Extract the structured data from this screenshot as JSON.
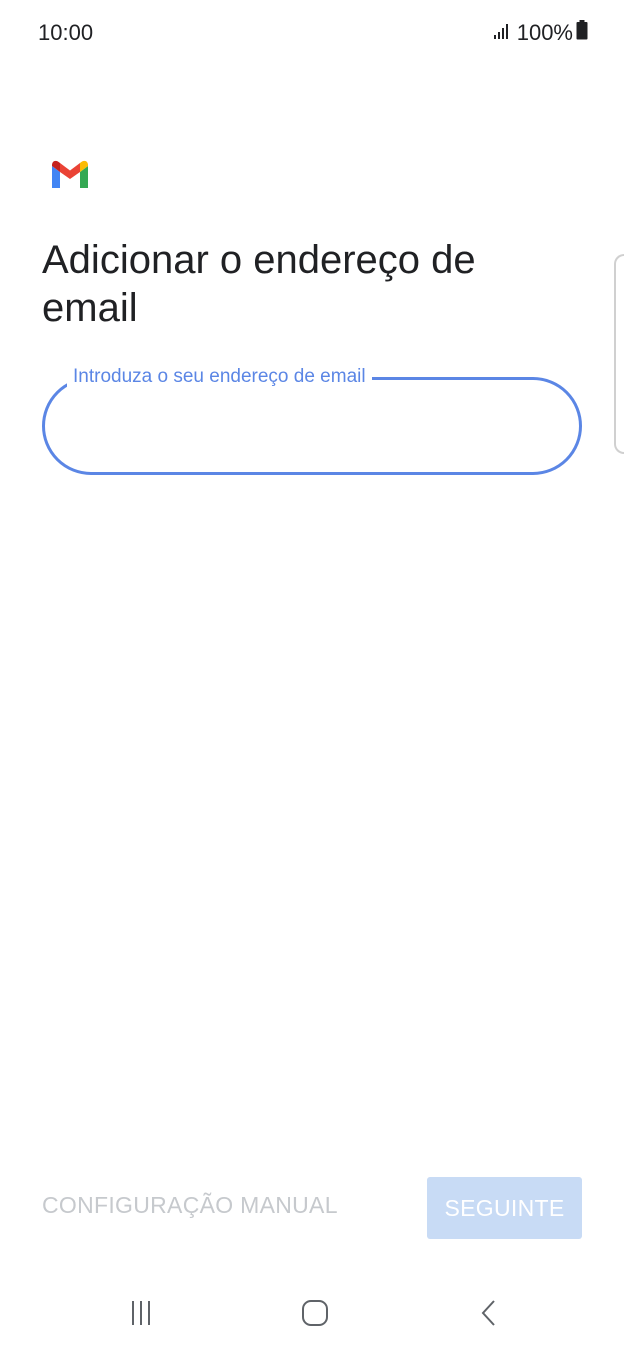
{
  "status_bar": {
    "time": "10:00",
    "battery": "100%",
    "icons": [
      "signal-icon",
      "battery-icon"
    ]
  },
  "app": {
    "logo": "gmail-logo",
    "title": "Adicionar o endereço de email"
  },
  "email_field": {
    "label": "Introduza o seu endereço de email",
    "value": ""
  },
  "actions": {
    "manual_config_label": "CONFIGURAÇÃO MANUAL",
    "next_label": "SEGUINTE"
  },
  "nav": {
    "icons": [
      "recents-icon",
      "home-icon",
      "back-icon"
    ]
  },
  "colors": {
    "accent": "#5b86e5",
    "disabled_text": "#c6c9cd",
    "disabled_button_bg": "#c8dbf5"
  }
}
